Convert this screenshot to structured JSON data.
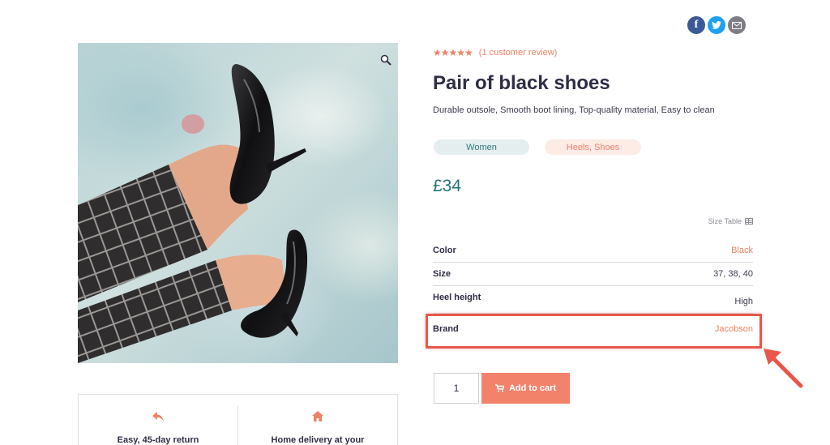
{
  "share": {
    "facebook_glyph": "f",
    "twitter_glyph": "🐦",
    "email_glyph": "✉"
  },
  "product": {
    "rating_stars": "★★★★★",
    "review_link": "(1 customer review)",
    "title": "Pair of black shoes",
    "description": "Durable outsole, Smooth boot lining, Top-quality material, Easy to clean",
    "tags": [
      "Women",
      "Heels, Shoes"
    ],
    "price": "£34"
  },
  "size_table": {
    "label": "Size Table"
  },
  "attributes": [
    {
      "label": "Color",
      "value": "Black"
    },
    {
      "label": "Size",
      "value": "37, 38, 40"
    },
    {
      "label": "Heel height",
      "value": "High"
    },
    {
      "label": "Brand",
      "value": "Jacobson"
    }
  ],
  "cart": {
    "quantity": "1",
    "add_label": "Add to cart"
  },
  "info_boxes": [
    {
      "icon": "reply-arrow-icon",
      "text": "Easy, 45-day return"
    },
    {
      "icon": "home-icon",
      "text": "Home delivery at your"
    }
  ],
  "colors": {
    "accent": "#f08264",
    "price": "#237675",
    "highlight": "#e9574a"
  }
}
